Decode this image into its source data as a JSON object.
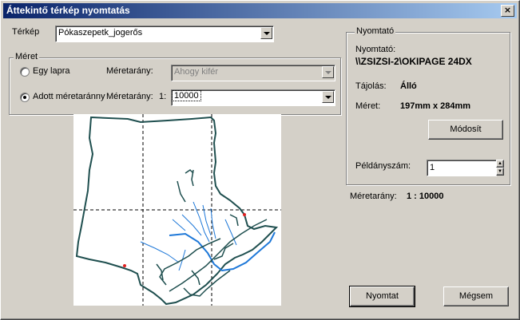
{
  "window": {
    "title": "Áttekintő térkép nyomtatás",
    "close_glyph": "×"
  },
  "map_row": {
    "label": "Térkép",
    "value": "Pókaszepetk_jogerős"
  },
  "scale_group": {
    "title": "Méret",
    "option_fit": {
      "label": "Egy lapra",
      "selected": false
    },
    "option_scale": {
      "label": "Adott méretaránny",
      "selected": true
    },
    "fit_scale_label": "Méretarány:",
    "fit_scale_value": "Ahogy kifér",
    "scale_label": "Méretarány:",
    "scale_prefix": "1:",
    "scale_value": "10000"
  },
  "printer_group": {
    "title": "Nyomtató",
    "printer_label": "Nyomtató:",
    "printer_name": "\\\\ZSIZSI-2\\OKIPAGE 24DX",
    "orientation_label": "Tájolás:",
    "orientation_value": "Álló",
    "size_label": "Méret:",
    "size_value": "197mm x 284mm",
    "modify_label": "Módosít",
    "copies_label": "Példányszám:",
    "copies_value": "1"
  },
  "scale_summary": {
    "label": "Méretarány:",
    "value": "1 : 10000"
  },
  "buttons": {
    "print": "Nyomtat",
    "cancel": "Mégsem"
  },
  "colors": {
    "title_start": "#0a246a",
    "title_end": "#a6caf0",
    "face": "#d4d0c8",
    "map_boundary": "#1f4f4f",
    "map_water": "#1e78d8",
    "map_marker": "#e02020"
  }
}
